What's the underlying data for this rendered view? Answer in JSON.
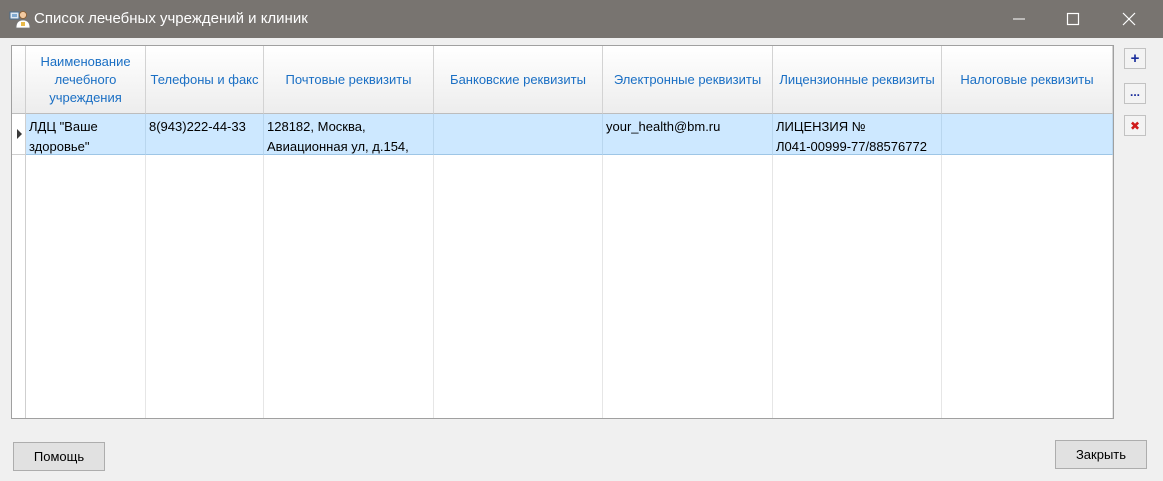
{
  "window": {
    "title": "Список лечебных учреждений и клиник",
    "icon": "doctor-icon"
  },
  "grid": {
    "columns": [
      "Наименование лечебного учреждения",
      "Телефоны и факс",
      "Почтовые реквизиты",
      "Банковские реквизиты",
      "Электронные реквизиты",
      "Лицензионные реквизиты",
      "Налоговые реквизиты"
    ],
    "rows": [
      {
        "name": "ЛДЦ \"Ваше здоровье\"",
        "phones": "8(943)222-44-33",
        "postal_line1": "128182, Москва,",
        "postal_line2": "Авиационная ул, д.154,",
        "bank": "",
        "electronic": "your_health@bm.ru",
        "license_line1": "ЛИЦЕНЗИЯ №",
        "license_line2": "Л041-00999-77/88576772",
        "tax": ""
      }
    ]
  },
  "toolbar": {
    "add_icon": "plus-icon",
    "edit_icon": "ellipsis-icon",
    "delete_icon": "delete-x-icon"
  },
  "buttons": {
    "help": "Помощь",
    "close": "Закрыть"
  }
}
